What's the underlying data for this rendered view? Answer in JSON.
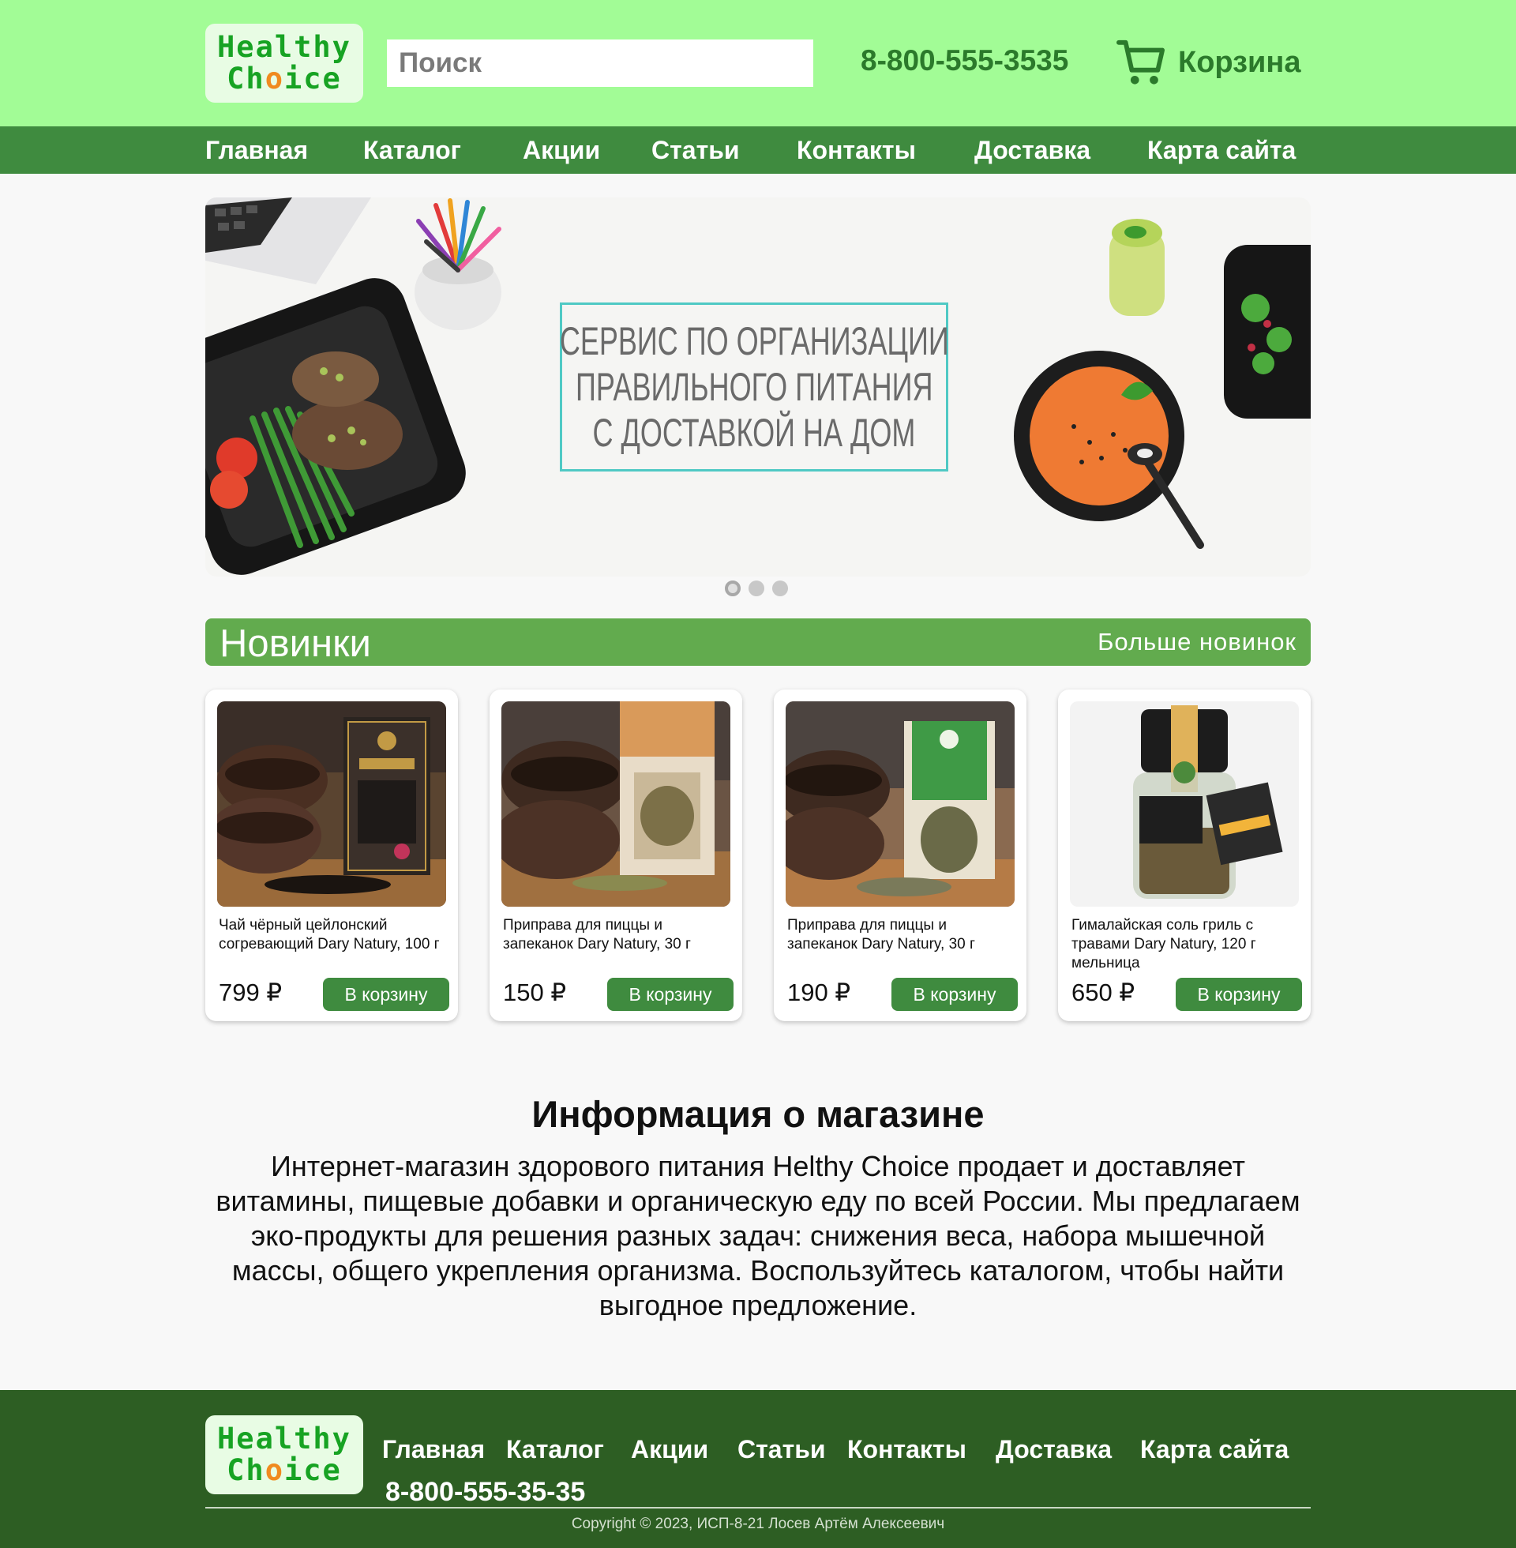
{
  "brand": {
    "line1": "Healthy",
    "line2_a": "Ch",
    "line2_o": "o",
    "line2_b": "ice"
  },
  "header": {
    "search_placeholder": "Поиск",
    "phone": "8-800-555-3535",
    "cart_label": "Корзина",
    "cart_icon": "shopping-cart-icon"
  },
  "nav": {
    "items": [
      {
        "label": "Главная"
      },
      {
        "label": "Каталог"
      },
      {
        "label": "Акции"
      },
      {
        "label": "Статьи"
      },
      {
        "label": "Контакты"
      },
      {
        "label": "Доставка"
      },
      {
        "label": "Карта сайта"
      }
    ]
  },
  "hero": {
    "lines": [
      "СЕРВИС ПО ОРГАНИЗАЦИИ",
      "ПРАВИЛЬНОГО ПИТАНИЯ",
      "С ДОСТАВКОЙ НА ДОМ"
    ],
    "slide_count": 3,
    "active_slide": 1
  },
  "new_arrivals": {
    "title": "Новинки",
    "more_link": "Больше новинок",
    "products": [
      {
        "name": "Чай чёрный цейлонский согревающий Dary Natury, 100 г",
        "price": "799 ₽",
        "button": "В корзину"
      },
      {
        "name": "Приправа для пиццы и запеканок Dary Natury, 30 г",
        "price": "150 ₽",
        "button": "В корзину"
      },
      {
        "name": "Приправа для пиццы и запеканок Dary Natury, 30 г",
        "price": "190 ₽",
        "button": "В корзину"
      },
      {
        "name": "Гималайская соль гриль с травами Dary Natury, 120 г мельница",
        "price": "650 ₽",
        "button": "В корзину"
      }
    ]
  },
  "info": {
    "title": "Информация о магазине",
    "text": "Интернет-магазин здорового питания Helthy Choice продает и доставляет витамины, пищевые добавки и органическую еду по всей России. Мы предлагаем эко-продукты для решения разных задач: снижения веса, набора мышечной массы, общего укрепления организма. Воспользуйтесь каталогом, чтобы найти выгодное предложение."
  },
  "footer": {
    "phone": "8-800-555-35-35",
    "copyright": "Copyright © 2023, ИСП-8-21 Лосев Артём Алексеевич"
  },
  "colors": {
    "header_bg": "#a2fc96",
    "nav_bg": "#3f8b3f",
    "accent_green": "#62ab4e",
    "footer_bg": "#2d5e23",
    "logo_text": "#17a323",
    "phone_text": "#2b7a2b"
  }
}
